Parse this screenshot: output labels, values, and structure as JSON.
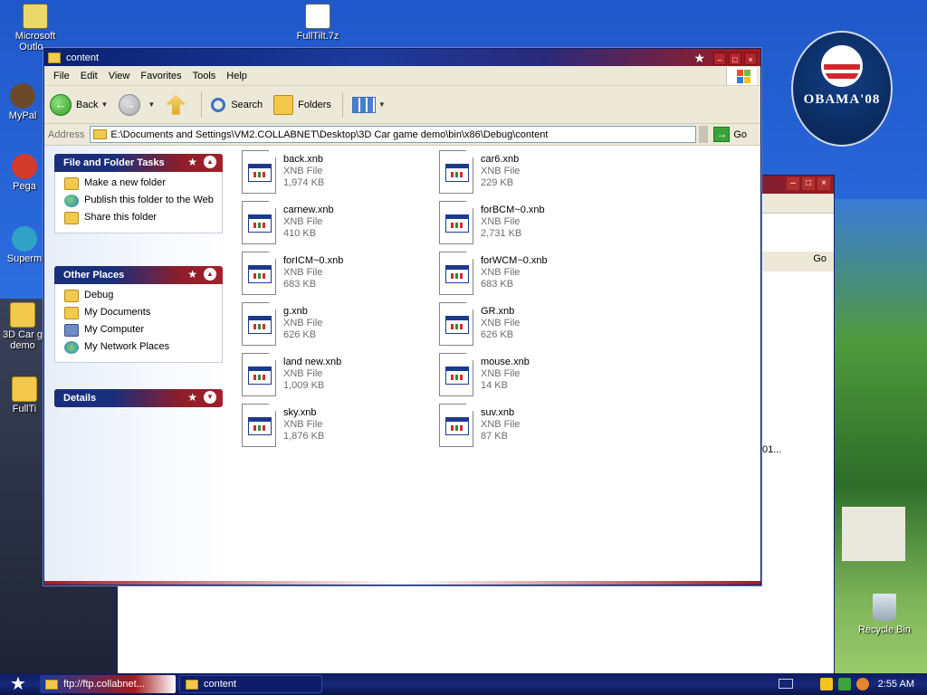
{
  "desktop": {
    "icons": [
      {
        "label": "Microsoft Outlo..."
      },
      {
        "label": "FullTilt.7z"
      },
      {
        "label": "MyPal"
      },
      {
        "label": "Pega"
      },
      {
        "label": "Superm"
      },
      {
        "label": "3D Car g demo"
      },
      {
        "label": "FullTi"
      }
    ],
    "badge_text": "OBAMA'08",
    "recycle_label": "Recycle Bin",
    "bg_window_go": "Go",
    "bg_window_truncated": "01..."
  },
  "window": {
    "title": "content",
    "menu": [
      "File",
      "Edit",
      "View",
      "Favorites",
      "Tools",
      "Help"
    ],
    "toolbar": {
      "back": "Back",
      "search": "Search",
      "folders": "Folders"
    },
    "address": {
      "label": "Address",
      "path": "E:\\Documents and Settings\\VM2.COLLABNET\\Desktop\\3D Car game demo\\bin\\x86\\Debug\\content",
      "go": "Go"
    },
    "tasks": {
      "file_folder_title": "File and Folder Tasks",
      "file_folder_items": [
        "Make a new folder",
        "Publish this folder to the Web",
        "Share this folder"
      ],
      "other_places_title": "Other Places",
      "other_places_items": [
        "Debug",
        "My Documents",
        "My Computer",
        "My Network Places"
      ],
      "details_title": "Details"
    },
    "files": [
      {
        "name": "back.xnb",
        "type": "XNB File",
        "size": "1,974 KB"
      },
      {
        "name": "car6.xnb",
        "type": "XNB File",
        "size": "229 KB"
      },
      {
        "name": "carnew.xnb",
        "type": "XNB File",
        "size": "410 KB"
      },
      {
        "name": "forBCM~0.xnb",
        "type": "XNB File",
        "size": "2,731 KB"
      },
      {
        "name": "forICM~0.xnb",
        "type": "XNB File",
        "size": "683 KB"
      },
      {
        "name": "forWCM~0.xnb",
        "type": "XNB File",
        "size": "683 KB"
      },
      {
        "name": "g.xnb",
        "type": "XNB File",
        "size": "626 KB"
      },
      {
        "name": "GR.xnb",
        "type": "XNB File",
        "size": "626 KB"
      },
      {
        "name": "land new.xnb",
        "type": "XNB File",
        "size": "1,009 KB"
      },
      {
        "name": "mouse.xnb",
        "type": "XNB File",
        "size": "14 KB"
      },
      {
        "name": "sky.xnb",
        "type": "XNB File",
        "size": "1,876 KB"
      },
      {
        "name": "suv.xnb",
        "type": "XNB File",
        "size": "87 KB"
      }
    ]
  },
  "taskbar": {
    "buttons": [
      {
        "label": "ftp://ftp.collabnet..."
      },
      {
        "label": "content"
      }
    ],
    "clock": "2:55 AM"
  },
  "colors": {
    "title_blue": "#0b2270",
    "title_red": "#a31b1b",
    "pane_bg": "#e6eef9"
  }
}
